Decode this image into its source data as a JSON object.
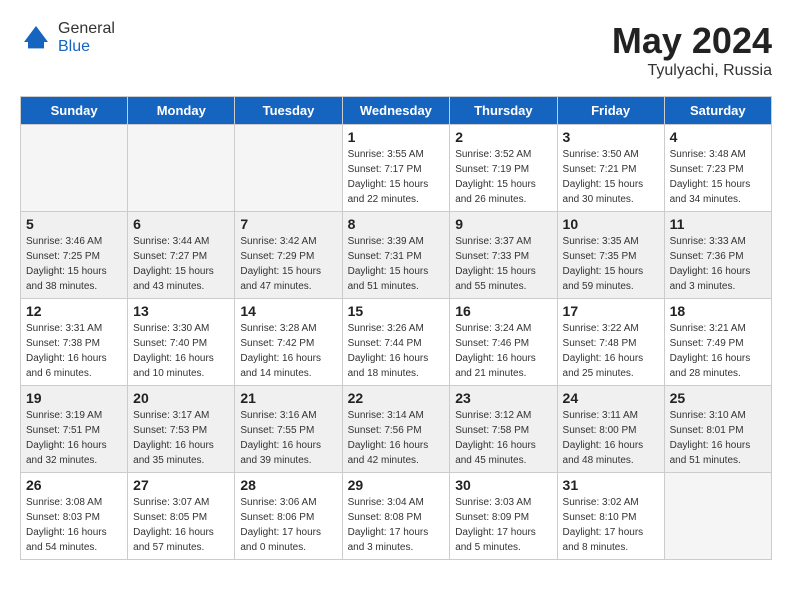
{
  "header": {
    "logo_general": "General",
    "logo_blue": "Blue",
    "month_year": "May 2024",
    "location": "Tyulyachi, Russia"
  },
  "days_of_week": [
    "Sunday",
    "Monday",
    "Tuesday",
    "Wednesday",
    "Thursday",
    "Friday",
    "Saturday"
  ],
  "weeks": [
    [
      {
        "day": "",
        "info": ""
      },
      {
        "day": "",
        "info": ""
      },
      {
        "day": "",
        "info": ""
      },
      {
        "day": "1",
        "info": "Sunrise: 3:55 AM\nSunset: 7:17 PM\nDaylight: 15 hours\nand 22 minutes."
      },
      {
        "day": "2",
        "info": "Sunrise: 3:52 AM\nSunset: 7:19 PM\nDaylight: 15 hours\nand 26 minutes."
      },
      {
        "day": "3",
        "info": "Sunrise: 3:50 AM\nSunset: 7:21 PM\nDaylight: 15 hours\nand 30 minutes."
      },
      {
        "day": "4",
        "info": "Sunrise: 3:48 AM\nSunset: 7:23 PM\nDaylight: 15 hours\nand 34 minutes."
      }
    ],
    [
      {
        "day": "5",
        "info": "Sunrise: 3:46 AM\nSunset: 7:25 PM\nDaylight: 15 hours\nand 38 minutes."
      },
      {
        "day": "6",
        "info": "Sunrise: 3:44 AM\nSunset: 7:27 PM\nDaylight: 15 hours\nand 43 minutes."
      },
      {
        "day": "7",
        "info": "Sunrise: 3:42 AM\nSunset: 7:29 PM\nDaylight: 15 hours\nand 47 minutes."
      },
      {
        "day": "8",
        "info": "Sunrise: 3:39 AM\nSunset: 7:31 PM\nDaylight: 15 hours\nand 51 minutes."
      },
      {
        "day": "9",
        "info": "Sunrise: 3:37 AM\nSunset: 7:33 PM\nDaylight: 15 hours\nand 55 minutes."
      },
      {
        "day": "10",
        "info": "Sunrise: 3:35 AM\nSunset: 7:35 PM\nDaylight: 15 hours\nand 59 minutes."
      },
      {
        "day": "11",
        "info": "Sunrise: 3:33 AM\nSunset: 7:36 PM\nDaylight: 16 hours\nand 3 minutes."
      }
    ],
    [
      {
        "day": "12",
        "info": "Sunrise: 3:31 AM\nSunset: 7:38 PM\nDaylight: 16 hours\nand 6 minutes."
      },
      {
        "day": "13",
        "info": "Sunrise: 3:30 AM\nSunset: 7:40 PM\nDaylight: 16 hours\nand 10 minutes."
      },
      {
        "day": "14",
        "info": "Sunrise: 3:28 AM\nSunset: 7:42 PM\nDaylight: 16 hours\nand 14 minutes."
      },
      {
        "day": "15",
        "info": "Sunrise: 3:26 AM\nSunset: 7:44 PM\nDaylight: 16 hours\nand 18 minutes."
      },
      {
        "day": "16",
        "info": "Sunrise: 3:24 AM\nSunset: 7:46 PM\nDaylight: 16 hours\nand 21 minutes."
      },
      {
        "day": "17",
        "info": "Sunrise: 3:22 AM\nSunset: 7:48 PM\nDaylight: 16 hours\nand 25 minutes."
      },
      {
        "day": "18",
        "info": "Sunrise: 3:21 AM\nSunset: 7:49 PM\nDaylight: 16 hours\nand 28 minutes."
      }
    ],
    [
      {
        "day": "19",
        "info": "Sunrise: 3:19 AM\nSunset: 7:51 PM\nDaylight: 16 hours\nand 32 minutes."
      },
      {
        "day": "20",
        "info": "Sunrise: 3:17 AM\nSunset: 7:53 PM\nDaylight: 16 hours\nand 35 minutes."
      },
      {
        "day": "21",
        "info": "Sunrise: 3:16 AM\nSunset: 7:55 PM\nDaylight: 16 hours\nand 39 minutes."
      },
      {
        "day": "22",
        "info": "Sunrise: 3:14 AM\nSunset: 7:56 PM\nDaylight: 16 hours\nand 42 minutes."
      },
      {
        "day": "23",
        "info": "Sunrise: 3:12 AM\nSunset: 7:58 PM\nDaylight: 16 hours\nand 45 minutes."
      },
      {
        "day": "24",
        "info": "Sunrise: 3:11 AM\nSunset: 8:00 PM\nDaylight: 16 hours\nand 48 minutes."
      },
      {
        "day": "25",
        "info": "Sunrise: 3:10 AM\nSunset: 8:01 PM\nDaylight: 16 hours\nand 51 minutes."
      }
    ],
    [
      {
        "day": "26",
        "info": "Sunrise: 3:08 AM\nSunset: 8:03 PM\nDaylight: 16 hours\nand 54 minutes."
      },
      {
        "day": "27",
        "info": "Sunrise: 3:07 AM\nSunset: 8:05 PM\nDaylight: 16 hours\nand 57 minutes."
      },
      {
        "day": "28",
        "info": "Sunrise: 3:06 AM\nSunset: 8:06 PM\nDaylight: 17 hours\nand 0 minutes."
      },
      {
        "day": "29",
        "info": "Sunrise: 3:04 AM\nSunset: 8:08 PM\nDaylight: 17 hours\nand 3 minutes."
      },
      {
        "day": "30",
        "info": "Sunrise: 3:03 AM\nSunset: 8:09 PM\nDaylight: 17 hours\nand 5 minutes."
      },
      {
        "day": "31",
        "info": "Sunrise: 3:02 AM\nSunset: 8:10 PM\nDaylight: 17 hours\nand 8 minutes."
      },
      {
        "day": "",
        "info": ""
      }
    ]
  ]
}
